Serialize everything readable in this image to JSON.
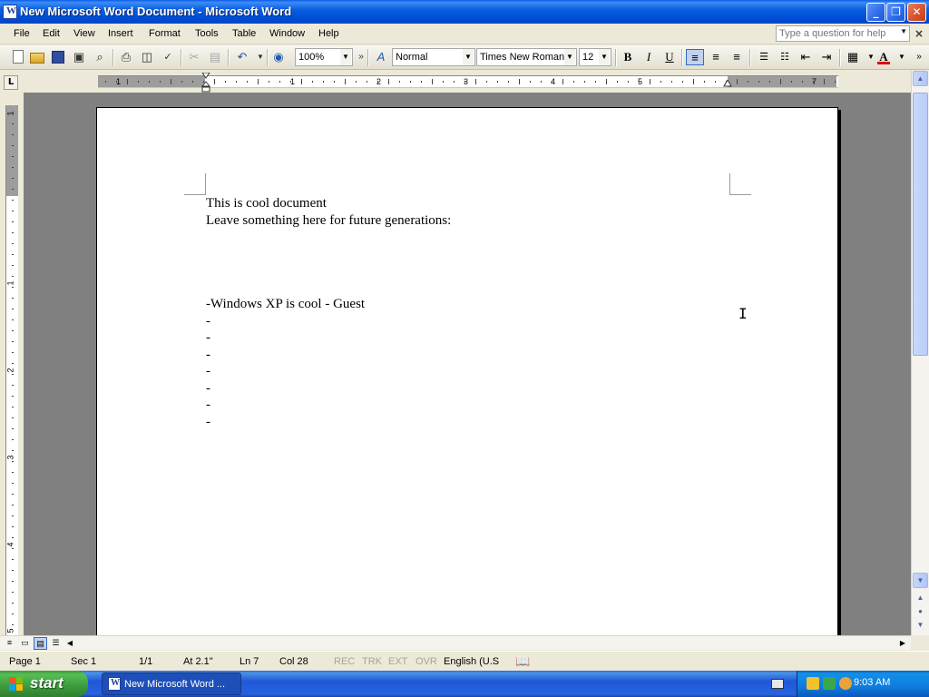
{
  "window": {
    "title": "New Microsoft Word Document - Microsoft Word",
    "controls": {
      "minimize": "_",
      "maximize": "❐",
      "close": "✕"
    }
  },
  "menu": {
    "items": [
      "File",
      "Edit",
      "View",
      "Insert",
      "Format",
      "Tools",
      "Table",
      "Window",
      "Help"
    ],
    "help_placeholder": "Type a question for help",
    "close_glyph": "×"
  },
  "toolbar": {
    "zoom": "100%",
    "style": "Normal",
    "font": "Times New Roman",
    "size": "12",
    "bold": "B",
    "italic": "I",
    "underline": "U",
    "more": "»",
    "font_color": "#e00000",
    "icons": [
      "new-icon",
      "open-icon",
      "save-icon",
      "permission-icon",
      "search-icon",
      "print-icon",
      "print-preview-icon",
      "spelling-icon",
      "cut-icon",
      "copy-icon",
      "paste-icon",
      "undo-icon",
      "research-icon",
      "styles-icon",
      "align-left-icon",
      "center-icon",
      "align-right-icon",
      "numbering-icon",
      "bullets-icon",
      "decrease-indent-icon",
      "increase-indent-icon",
      "borders-icon",
      "font-color-icon"
    ]
  },
  "ruler": {
    "tab_selector": "L",
    "numbers": [
      "1",
      "1",
      "2",
      "3",
      "4",
      "5",
      "7"
    ],
    "vertical_numbers": [
      "1",
      "1",
      "2",
      "3",
      "4",
      "5"
    ]
  },
  "document": {
    "lines": [
      "This is cool document",
      "Leave something here for future generations:",
      "",
      "",
      "",
      "-Windows XP is cool - Guest",
      "-",
      "-",
      "-",
      "-",
      "-",
      "-",
      "-"
    ]
  },
  "status": {
    "page": "Page  1",
    "sec": "Sec  1",
    "pages": "1/1",
    "at": "At  2.1\"",
    "ln": "Ln  7",
    "col": "Col  28",
    "rec": "REC",
    "trk": "TRK",
    "ext": "EXT",
    "ovr": "OVR",
    "language": "English (U.S"
  },
  "taskbar": {
    "start": "start",
    "task_label": "New Microsoft Word ...",
    "clock": "9:03 AM"
  },
  "colors": {
    "titlebar": "#0050d8",
    "taskbar": "#2157d7",
    "start_button": "#3c9a3c",
    "page_background": "#808080"
  }
}
